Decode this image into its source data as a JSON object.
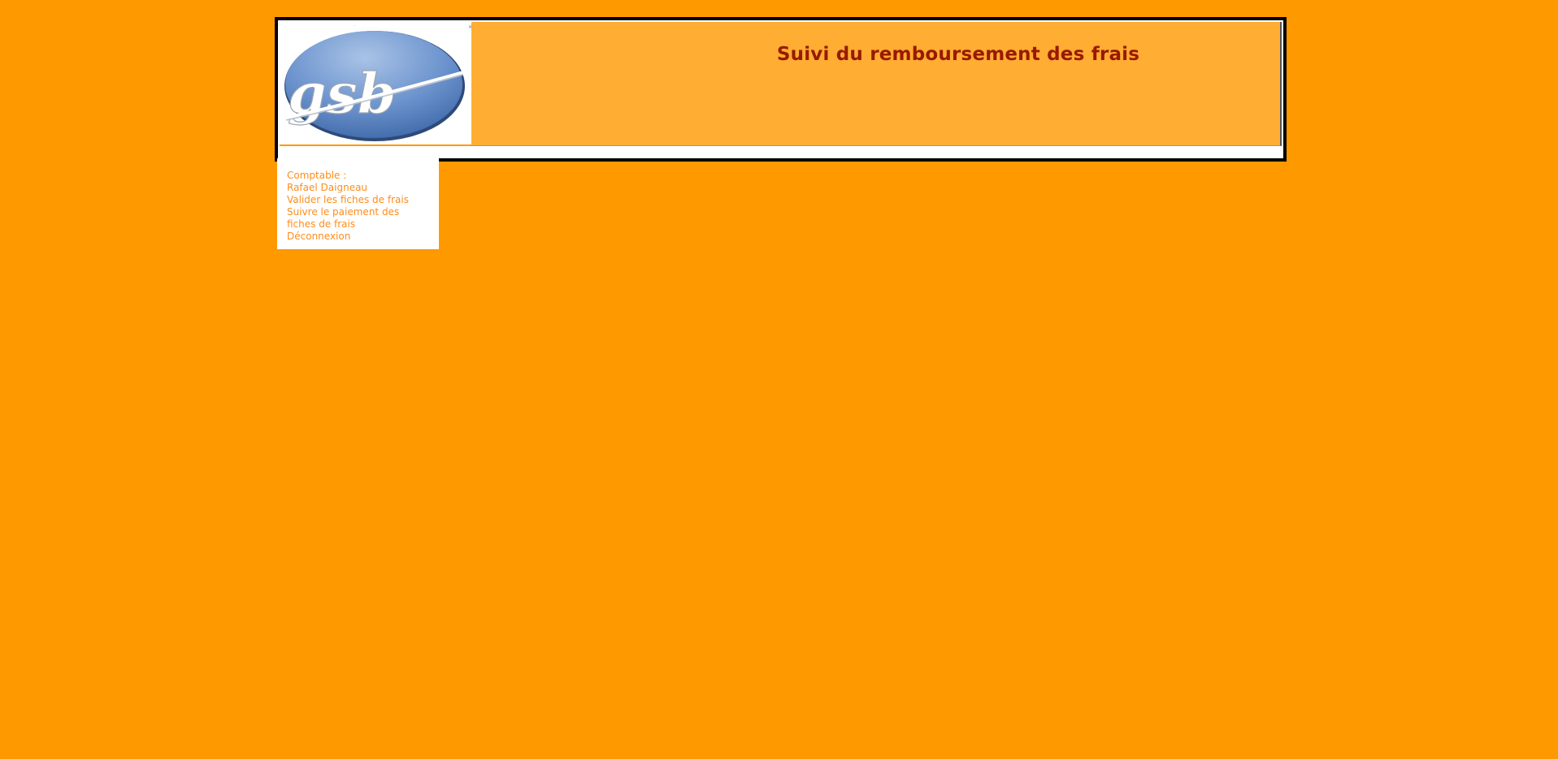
{
  "app": {
    "title": "Suivi du remboursement des frais",
    "logo_text": "gsb"
  },
  "menu": {
    "role_label": "Comptable :",
    "user_name": "Rafael Daigneau",
    "items": [
      {
        "label": "Valider les fiches de frais"
      },
      {
        "label": "Suivre le paiement des fiches de frais"
      },
      {
        "label": "Déconnexion"
      }
    ]
  },
  "colors": {
    "background": "#FF9900",
    "banner": "#FFAD33",
    "title": "#991900",
    "menu_text": "#FF8C1A",
    "logo_blue": "#5B86C2"
  }
}
